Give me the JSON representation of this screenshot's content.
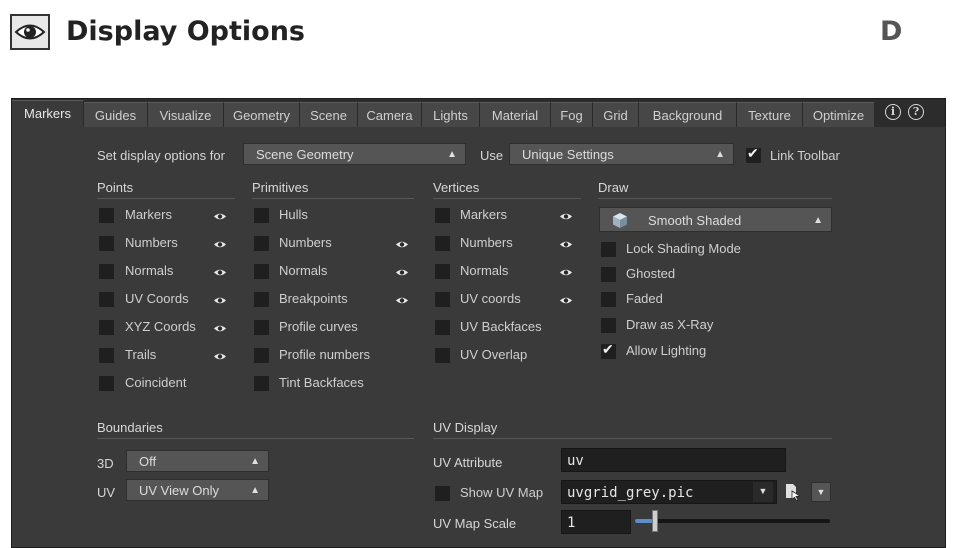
{
  "page": {
    "title": "Display Options",
    "corner_letter": "D",
    "title_icon": "eye-icon"
  },
  "tabs": [
    "Markers",
    "Guides",
    "Visualize",
    "Geometry",
    "Scene",
    "Camera",
    "Lights",
    "Material",
    "Fog",
    "Grid",
    "Background",
    "Texture",
    "Optimize"
  ],
  "active_tab": "Markers",
  "help_icons": [
    "info-icon",
    "help-icon"
  ],
  "top_row": {
    "set_for_label": "Set display options for",
    "set_for_value": "Scene Geometry",
    "use_label": "Use",
    "use_value": "Unique Settings",
    "link_toolbar_label": "Link Toolbar",
    "link_toolbar_checked": true
  },
  "points": {
    "title": "Points",
    "items": [
      {
        "label": "Markers",
        "eye": true
      },
      {
        "label": "Numbers",
        "eye": true
      },
      {
        "label": "Normals",
        "eye": true
      },
      {
        "label": "UV Coords",
        "eye": true
      },
      {
        "label": "XYZ Coords",
        "eye": true
      },
      {
        "label": "Trails",
        "eye": true
      },
      {
        "label": "Coincident",
        "eye": false
      }
    ]
  },
  "primitives": {
    "title": "Primitives",
    "items": [
      {
        "label": "Hulls",
        "eye": false
      },
      {
        "label": "Numbers",
        "eye": true
      },
      {
        "label": "Normals",
        "eye": true
      },
      {
        "label": "Breakpoints",
        "eye": true
      },
      {
        "label": "Profile curves",
        "eye": false
      },
      {
        "label": "Profile numbers",
        "eye": false
      },
      {
        "label": "Tint Backfaces",
        "eye": false
      }
    ]
  },
  "vertices": {
    "title": "Vertices",
    "items": [
      {
        "label": "Markers",
        "eye": true
      },
      {
        "label": "Numbers",
        "eye": true
      },
      {
        "label": "Normals",
        "eye": true
      },
      {
        "label": "UV coords",
        "eye": true
      },
      {
        "label": "UV Backfaces",
        "eye": false
      },
      {
        "label": "UV Overlap",
        "eye": false
      }
    ]
  },
  "draw": {
    "title": "Draw",
    "mode_value": "Smooth Shaded",
    "mode_icon": "cube-icon",
    "items": [
      {
        "label": "Lock Shading Mode",
        "checked": false
      },
      {
        "label": "Ghosted",
        "checked": false
      },
      {
        "label": "Faded",
        "checked": false
      },
      {
        "label": "Draw as X-Ray",
        "checked": false
      },
      {
        "label": "Allow Lighting",
        "checked": true
      }
    ]
  },
  "boundaries": {
    "title": "Boundaries",
    "rows": [
      {
        "label": "3D",
        "value": "Off"
      },
      {
        "label": "UV",
        "value": "UV View Only"
      }
    ]
  },
  "uv_display": {
    "title": "UV Display",
    "attribute_label": "UV Attribute",
    "attribute_value": "uv",
    "show_map_label": "Show UV Map",
    "show_map_checked": false,
    "map_file": "uvgrid_grey.pic",
    "scale_label": "UV Map Scale",
    "scale_value": "1"
  },
  "colors": {
    "panel_bg": "#3a3a3a",
    "field_bg": "#1f1f1f",
    "tab_bg": "#474747"
  }
}
